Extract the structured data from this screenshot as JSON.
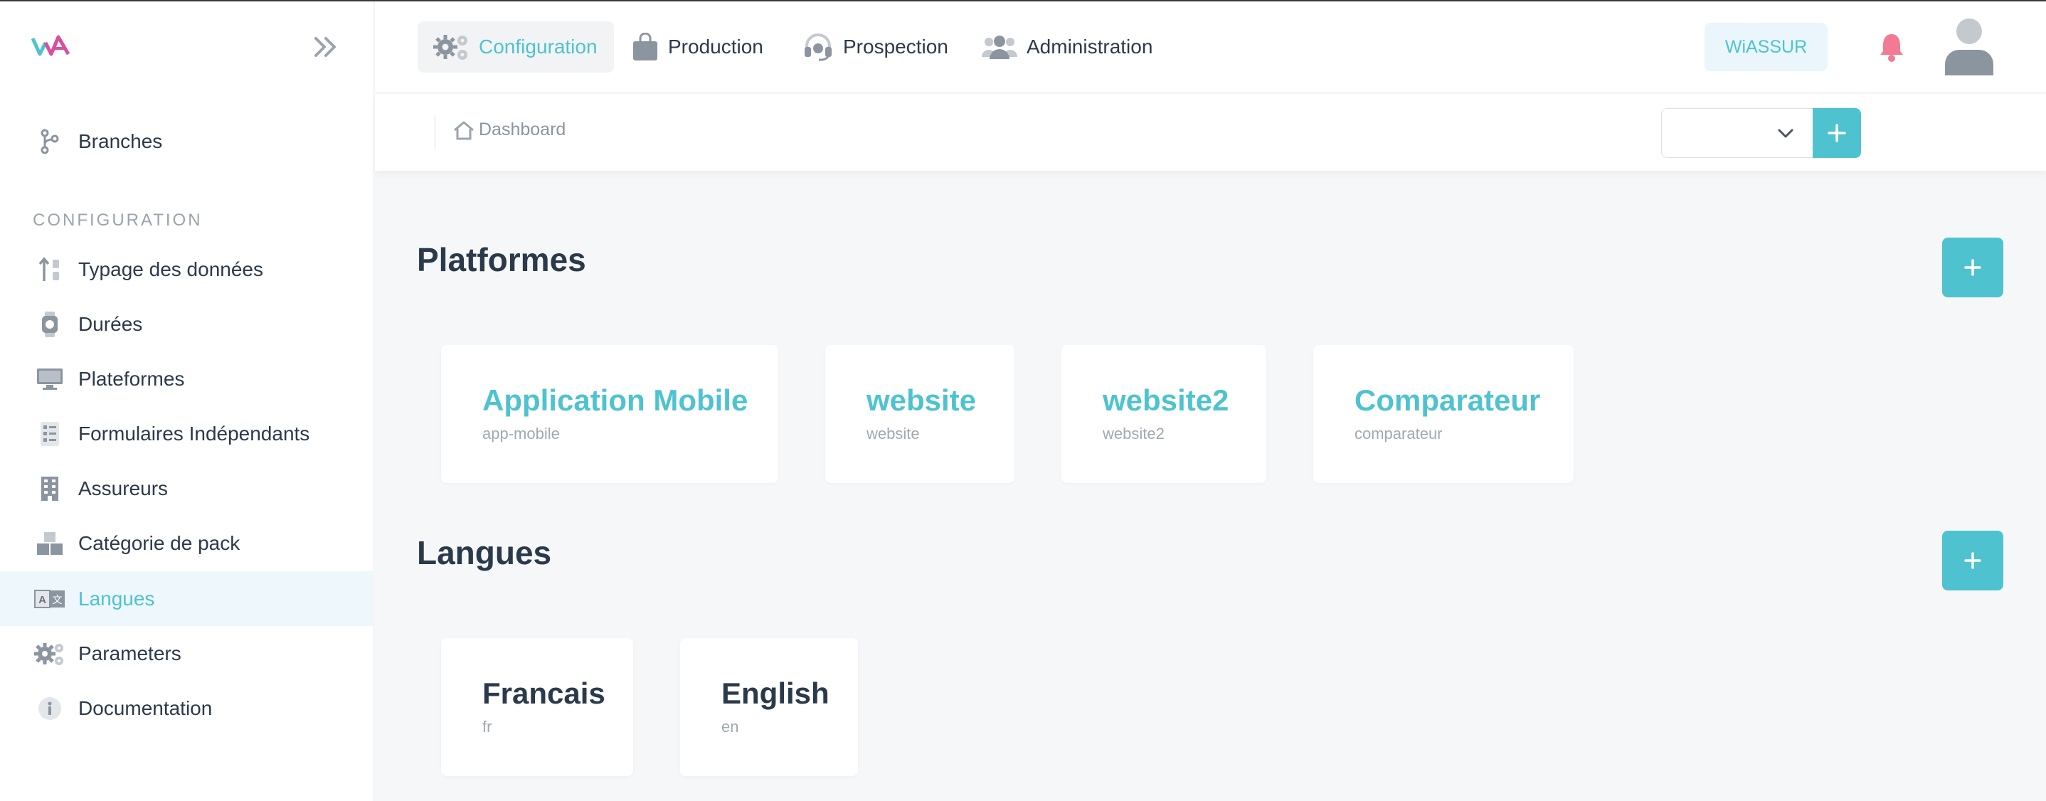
{
  "colors": {
    "accent": "#4ec3cf",
    "text": "#2b3a4a",
    "muted": "#a0a8b1",
    "bell": "#f27b93"
  },
  "brand": {
    "logo_text": "WA"
  },
  "sidebar": {
    "top_items": [
      {
        "label": "Branches",
        "icon": "branch-icon"
      }
    ],
    "section_title": "CONFIGURATION",
    "items": [
      {
        "label": "Typage des données",
        "icon": "sort-icon"
      },
      {
        "label": "Durées",
        "icon": "watch-icon"
      },
      {
        "label": "Plateformes",
        "icon": "monitor-icon"
      },
      {
        "label": "Formulaires Indépendants",
        "icon": "list-icon"
      },
      {
        "label": "Assureurs",
        "icon": "building-icon"
      },
      {
        "label": "Catégorie de pack",
        "icon": "boxes-icon"
      },
      {
        "label": "Langues",
        "icon": "translate-icon",
        "active": true
      },
      {
        "label": "Parameters",
        "icon": "gears-icon"
      },
      {
        "label": "Documentation",
        "icon": "info-icon"
      }
    ]
  },
  "topnav": {
    "items": [
      {
        "label": "Configuration",
        "icon": "gears-icon",
        "active": true
      },
      {
        "label": "Production",
        "icon": "bag-icon"
      },
      {
        "label": "Prospection",
        "icon": "headset-icon"
      },
      {
        "label": "Administration",
        "icon": "users-icon"
      }
    ],
    "tenant_label": "WiASSUR"
  },
  "breadcrumb": {
    "label": "Dashboard"
  },
  "platforms": {
    "title": "Platformes",
    "cards": [
      {
        "name": "Application Mobile",
        "code": "app-mobile"
      },
      {
        "name": "website",
        "code": "website"
      },
      {
        "name": "website2",
        "code": "website2"
      },
      {
        "name": "Comparateur",
        "code": "comparateur"
      }
    ]
  },
  "languages": {
    "title": "Langues",
    "cards": [
      {
        "name": "Francais",
        "code": "fr"
      },
      {
        "name": "English",
        "code": "en"
      }
    ]
  }
}
